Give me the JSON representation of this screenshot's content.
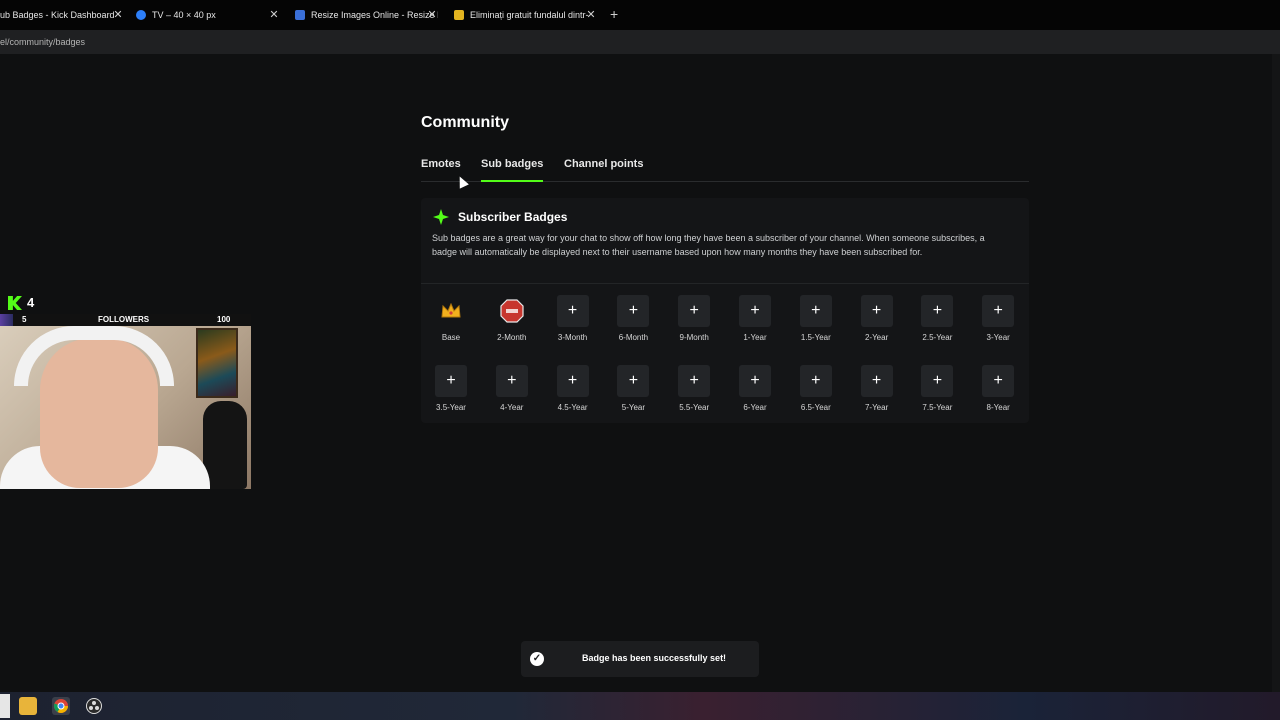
{
  "browser": {
    "tabs": [
      {
        "title": "ub Badges - Kick Dashboard",
        "favicon_color": "#53fc18"
      },
      {
        "title": "TV – 40 × 40 px",
        "favicon_color": "#2d7ff9"
      },
      {
        "title": "Resize Images Online - Resize I",
        "favicon_color": "#3a6fd8"
      },
      {
        "title": "Eliminați gratuit fundalul dintr-",
        "favicon_color": "#e3b420"
      }
    ],
    "new_tab": "+",
    "url": "el/community/badges"
  },
  "page": {
    "title": "Community",
    "tabs": [
      {
        "label": "Emotes"
      },
      {
        "label": "Sub badges"
      },
      {
        "label": "Channel points"
      }
    ],
    "active_tab": "Sub badges"
  },
  "card": {
    "title": "Subscriber Badges",
    "description": "Sub badges are a great way for your chat to show off how long they have been a subscriber of your channel. When someone subscribes, a badge will automatically be displayed next to their username based upon how many months they have been subscribed for.",
    "badges": [
      {
        "label": "Base",
        "icon": "crown-icon",
        "state": "set"
      },
      {
        "label": "2-Month",
        "icon": "stop-sign-icon",
        "state": "set"
      },
      {
        "label": "3-Month",
        "icon": "plus-icon",
        "state": "empty"
      },
      {
        "label": "6-Month",
        "icon": "plus-icon",
        "state": "empty"
      },
      {
        "label": "9-Month",
        "icon": "plus-icon",
        "state": "empty"
      },
      {
        "label": "1-Year",
        "icon": "plus-icon",
        "state": "empty"
      },
      {
        "label": "1.5-Year",
        "icon": "plus-icon",
        "state": "empty"
      },
      {
        "label": "2-Year",
        "icon": "plus-icon",
        "state": "empty"
      },
      {
        "label": "2.5-Year",
        "icon": "plus-icon",
        "state": "empty"
      },
      {
        "label": "3-Year",
        "icon": "plus-icon",
        "state": "empty"
      },
      {
        "label": "3.5-Year",
        "icon": "plus-icon",
        "state": "empty"
      },
      {
        "label": "4-Year",
        "icon": "plus-icon",
        "state": "empty"
      },
      {
        "label": "4.5-Year",
        "icon": "plus-icon",
        "state": "empty"
      },
      {
        "label": "5-Year",
        "icon": "plus-icon",
        "state": "empty"
      },
      {
        "label": "5.5-Year",
        "icon": "plus-icon",
        "state": "empty"
      },
      {
        "label": "6-Year",
        "icon": "plus-icon",
        "state": "empty"
      },
      {
        "label": "6.5-Year",
        "icon": "plus-icon",
        "state": "empty"
      },
      {
        "label": "7-Year",
        "icon": "plus-icon",
        "state": "empty"
      },
      {
        "label": "7.5-Year",
        "icon": "plus-icon",
        "state": "empty"
      },
      {
        "label": "8-Year",
        "icon": "plus-icon",
        "state": "empty"
      }
    ],
    "plus_glyph": "+"
  },
  "overlay": {
    "kick_count": "4",
    "followers_current": "5",
    "followers_label": "FOLLOWERS",
    "followers_goal": "100",
    "followers_progress": 0.05
  },
  "toast": {
    "icon": "check-circle-icon",
    "check_glyph": "✓",
    "message": "Badge has been successfully set!"
  },
  "colors": {
    "accent": "#53fc18",
    "background": "#0f1011",
    "card": "#141517"
  }
}
